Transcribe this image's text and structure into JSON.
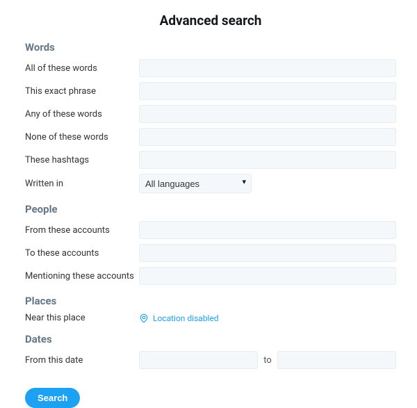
{
  "title": "Advanced search",
  "sections": {
    "words": {
      "heading": "Words",
      "all": "All of these words",
      "exact": "This exact phrase",
      "any": "Any of these words",
      "none": "None of these words",
      "hashtags": "These hashtags",
      "written_in": "Written in",
      "language_selected": "All languages"
    },
    "people": {
      "heading": "People",
      "from": "From these accounts",
      "to": "To these accounts",
      "mentioning": "Mentioning these accounts"
    },
    "places": {
      "heading": "Places",
      "near": "Near this place",
      "location_status": "Location disabled"
    },
    "dates": {
      "heading": "Dates",
      "from": "From this date",
      "separator": "to"
    }
  },
  "values": {
    "words_all": "",
    "words_exact": "",
    "words_any": "",
    "words_none": "",
    "words_hashtags": "",
    "people_from": "",
    "people_to": "",
    "people_mentioning": "",
    "date_from": "",
    "date_to": ""
  },
  "search_button": "Search"
}
